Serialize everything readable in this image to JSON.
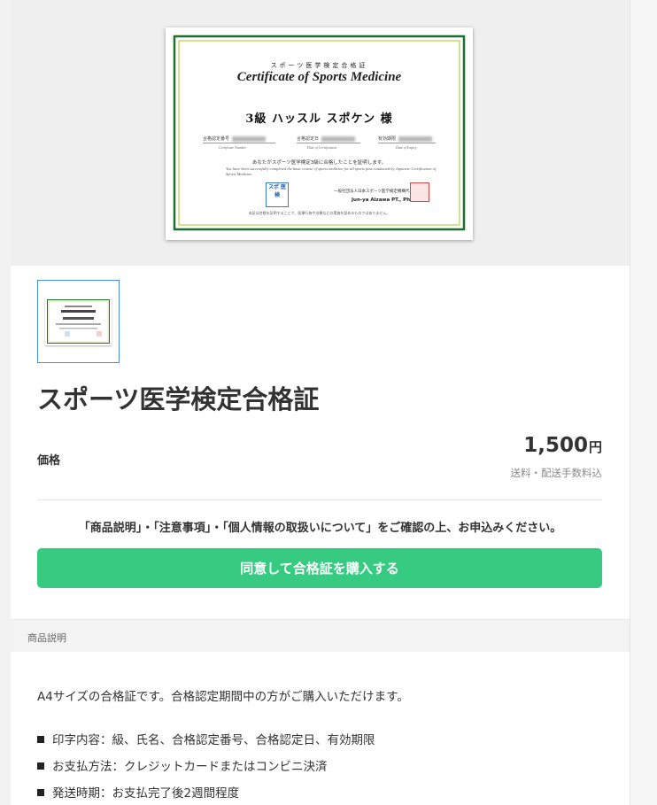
{
  "certificate_image": {
    "title_jp": "スポーツ医学検定合格証",
    "title_en": "Certificate of Sports Medicine",
    "recipient": "3級  ハッスル スポケン 様",
    "field_number_jp": "合格認定番号",
    "field_number_en": "Certificate Number",
    "field_date_jp": "合格認定日",
    "field_date_en": "Date of Certification",
    "field_expiry_jp": "有効期限",
    "field_expiry_en": "Date of Expiry",
    "statement_jp": "あなたがスポーツ医学検定3級に合格したことを証明します。",
    "statement_en": "You have been successfully completed the basic course of sports medicine for all sports fans conducted by Japanese Certification of Sports Medicine.",
    "logo_text": "スポ 医検",
    "issuer": "一般社団法人日本スポーツ医学検定機構代表理事",
    "signer": "Jun-ya Aizawa PT., PhD.",
    "footnote": "本証は合格を証明することで、医療行為や治療などの実施を認めるものではありません。"
  },
  "product": {
    "title": "スポーツ医学検定合格証",
    "price_label": "価格",
    "price_number": "1,500",
    "price_unit": "円",
    "shipping": "送料・配送手数料込"
  },
  "notice": "「商品説明」・「注意事項」・「個人情報の取扱いについて」をご確認の上、お申込みください。",
  "buy_button": "同意して合格証を購入する",
  "description": {
    "section_label": "商品説明",
    "lead": "A4サイズの合格証です。合格認定期間中の方がご購入いただけます。",
    "items": [
      "印字内容：級、氏名、合格認定番号、合格認定日、有効期限",
      "お支払方法：クレジットカードまたはコンビニ決済",
      "発送時期：お支払完了後2週間程度"
    ]
  }
}
